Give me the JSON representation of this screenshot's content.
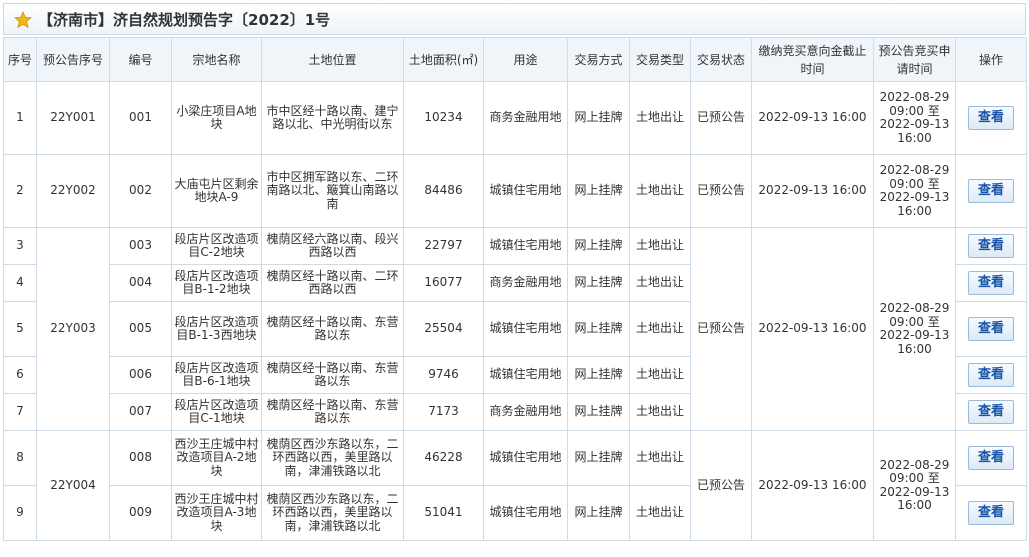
{
  "page": {
    "title": "【济南市】济自然规划预告字〔2022〕1号"
  },
  "colors": {
    "header_bg": "#f0f5fa",
    "border": "#cfdbe6",
    "button_text": "#1a55a8",
    "star": "#f2b51a"
  },
  "icons": {
    "title": "star-icon"
  },
  "table": {
    "headers": [
      "序号",
      "预公告序号",
      "编号",
      "宗地名称",
      "土地位置",
      "土地面积(㎡)",
      "用途",
      "交易方式",
      "交易类型",
      "交易状态",
      "缴纳竞买意向金截止时间",
      "预公告竞买申请时间",
      "操作"
    ],
    "rows": [
      {
        "seq": "1",
        "notice_no": "22Y001",
        "code": "001",
        "name": "小梁庄项目A地块",
        "location": "市中区经十路以南、建宁路以北、中光明街以东",
        "area": "10234",
        "use": "商务金融用地",
        "method": "网上挂牌",
        "type": "土地出让",
        "status": "已预公告",
        "deadline": "2022-09-13 16:00",
        "apply_time": "2022-08-29 09:00 至 2022-09-13 16:00",
        "action": "查看"
      },
      {
        "seq": "2",
        "notice_no": "22Y002",
        "code": "002",
        "name": "大庙屯片区剩余地块A-9",
        "location": "市中区拥军路以东、二环南路以北、簸箕山南路以南",
        "area": "84486",
        "use": "城镇住宅用地",
        "method": "网上挂牌",
        "type": "土地出让",
        "status": "已预公告",
        "deadline": "2022-09-13 16:00",
        "apply_time": "2022-08-29 09:00 至 2022-09-13 16:00",
        "action": "查看"
      },
      {
        "seq": "3",
        "notice_no": "22Y003",
        "code": "003",
        "name": "段店片区改造项目C-2地块",
        "location": "槐荫区经六路以南、段兴西路以西",
        "area": "22797",
        "use": "城镇住宅用地",
        "method": "网上挂牌",
        "type": "土地出让",
        "status": "已预公告",
        "deadline": "2022-09-13 16:00",
        "apply_time": "2022-08-29 09:00 至 2022-09-13 16:00",
        "action": "查看"
      },
      {
        "seq": "4",
        "notice_no": "22Y003",
        "code": "004",
        "name": "段店片区改造项目B-1-2地块",
        "location": "槐荫区经十路以南、二环西路以西",
        "area": "16077",
        "use": "商务金融用地",
        "method": "网上挂牌",
        "type": "土地出让",
        "status": "已预公告",
        "deadline": "2022-09-13 16:00",
        "apply_time": "2022-08-29 09:00 至 2022-09-13 16:00",
        "action": "查看"
      },
      {
        "seq": "5",
        "notice_no": "22Y003",
        "code": "005",
        "name": "段店片区改造项目B-1-3西地块",
        "location": "槐荫区经十路以南、东营路以东",
        "area": "25504",
        "use": "城镇住宅用地",
        "method": "网上挂牌",
        "type": "土地出让",
        "status": "已预公告",
        "deadline": "2022-09-13 16:00",
        "apply_time": "2022-08-29 09:00 至 2022-09-13 16:00",
        "action": "查看"
      },
      {
        "seq": "6",
        "notice_no": "22Y003",
        "code": "006",
        "name": "段店片区改造项目B-6-1地块",
        "location": "槐荫区经十路以南、东营路以东",
        "area": "9746",
        "use": "城镇住宅用地",
        "method": "网上挂牌",
        "type": "土地出让",
        "status": "已预公告",
        "deadline": "2022-09-13 16:00",
        "apply_time": "2022-08-29 09:00 至 2022-09-13 16:00",
        "action": "查看"
      },
      {
        "seq": "7",
        "notice_no": "22Y003",
        "code": "007",
        "name": "段店片区改造项目C-1地块",
        "location": "槐荫区经十路以南、东营路以东",
        "area": "7173",
        "use": "商务金融用地",
        "method": "网上挂牌",
        "type": "土地出让",
        "status": "已预公告",
        "deadline": "2022-09-13 16:00",
        "apply_time": "2022-08-29 09:00 至 2022-09-13 16:00",
        "action": "查看"
      },
      {
        "seq": "8",
        "notice_no": "22Y004",
        "code": "008",
        "name": "西沙王庄城中村改造项目A-2地块",
        "location": "槐荫区西沙东路以东，二环西路以西，美里路以南，津浦铁路以北",
        "area": "46228",
        "use": "城镇住宅用地",
        "method": "网上挂牌",
        "type": "土地出让",
        "status": "已预公告",
        "deadline": "2022-09-13 16:00",
        "apply_time": "2022-08-29 09:00 至 2022-09-13 16:00",
        "action": "查看"
      },
      {
        "seq": "9",
        "notice_no": "22Y004",
        "code": "009",
        "name": "西沙王庄城中村改造项目A-3地块",
        "location": "槐荫区西沙东路以东，二环西路以西，美里路以南，津浦铁路以北",
        "area": "51041",
        "use": "城镇住宅用地",
        "method": "网上挂牌",
        "type": "土地出让",
        "status": "已预公告",
        "deadline": "2022-09-13 16:00",
        "apply_time": "2022-08-29 09:00 至 2022-09-13 16:00",
        "action": "查看"
      }
    ]
  }
}
